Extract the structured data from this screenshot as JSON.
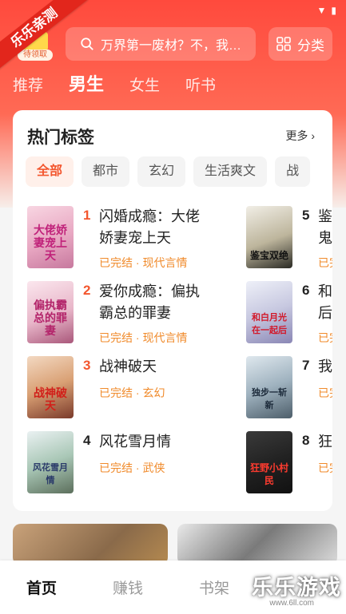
{
  "status_bar": {
    "wifi_icon": "wifi-icon",
    "battery_icon": "battery-icon"
  },
  "promo": {
    "banner_text": "乐乐亲测",
    "gift_tag": "待领取"
  },
  "search": {
    "placeholder": "万界第一废材？不，我…",
    "icon": "search-icon"
  },
  "classify": {
    "label": "分类",
    "icon": "grid-icon"
  },
  "tabs": [
    {
      "label": "推荐",
      "active": false
    },
    {
      "label": "男生",
      "active": true
    },
    {
      "label": "女生",
      "active": false
    },
    {
      "label": "听书",
      "active": false
    }
  ],
  "hot_tags": {
    "title": "热门标签",
    "more": "更多",
    "chips": [
      "全部",
      "都市",
      "玄幻",
      "生活爽文",
      "战"
    ],
    "books_left": [
      {
        "rank": "1",
        "title_line1": "闪婚成瘾：大佬",
        "title_line2": "娇妻宠上天",
        "meta": "已完结 · 现代言情",
        "cover_text": "大佬娇妻宠上天"
      },
      {
        "rank": "2",
        "title_line1": "爱你成瘾：偏执",
        "title_line2": "霸总的罪妻",
        "meta": "已完结 · 现代言情",
        "cover_text": "偏执霸总的罪妻"
      },
      {
        "rank": "3",
        "title_line1": "战神破天",
        "title_line2": "",
        "meta": "已完结 · 玄幻",
        "cover_text": "战神破天"
      },
      {
        "rank": "4",
        "title_line1": "风花雪月情",
        "title_line2": "",
        "meta": "已完结 · 武侠",
        "cover_text": "风花雪月情"
      }
    ],
    "books_right": [
      {
        "rank": "5",
        "title_line1": "鉴",
        "title_line2": "鬼",
        "meta": "已完",
        "cover_text": "鉴宝双绝"
      },
      {
        "rank": "6",
        "title_line1": "和",
        "title_line2": "后",
        "meta": "已完",
        "cover_text": "和白月光在一起后"
      },
      {
        "rank": "7",
        "title_line1": "我",
        "title_line2": "",
        "meta": "已完",
        "cover_text": "独步一斩新"
      },
      {
        "rank": "8",
        "title_line1": "狂",
        "title_line2": "",
        "meta": "已完",
        "cover_text": "狂野小村民"
      }
    ]
  },
  "bottom_nav": [
    "首页",
    "赚钱",
    "书架"
  ],
  "watermark": {
    "text": "乐乐游戏",
    "url": "www.6ll.com"
  },
  "colors": {
    "brand": "#ff4a3d",
    "rank_top": "#f3562e",
    "meta": "#f08a2a"
  }
}
